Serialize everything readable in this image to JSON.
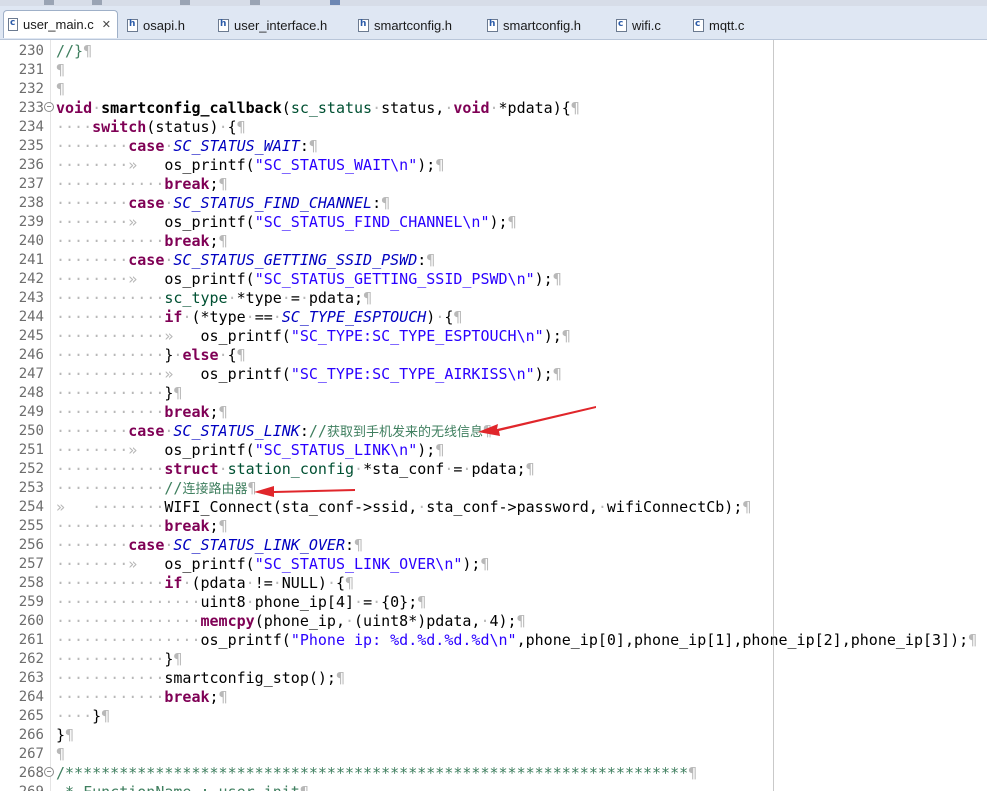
{
  "tabs": [
    {
      "label": "user_main.c",
      "icon": "c-file-icon",
      "glyph": "c",
      "active": true,
      "close": "✕"
    },
    {
      "label": "osapi.h",
      "icon": "h-file-icon",
      "glyph": "h"
    },
    {
      "label": "user_interface.h",
      "icon": "h-file-icon",
      "glyph": "h"
    },
    {
      "label": "smartconfig.h",
      "icon": "h-file-icon",
      "glyph": "h"
    },
    {
      "label": "smartconfig.h",
      "icon": "h-file-icon",
      "glyph": "h"
    },
    {
      "label": "wifi.c",
      "icon": "c-file-icon",
      "glyph": "c"
    },
    {
      "label": "mqtt.c",
      "icon": "c-file-icon",
      "glyph": "c"
    }
  ],
  "editor": {
    "lines": [
      {
        "n": "230",
        "t": [
          [
            "cm",
            "//}"
          ],
          [
            "ws",
            "¶"
          ]
        ]
      },
      {
        "n": "231",
        "t": [
          [
            "ws",
            "¶"
          ]
        ]
      },
      {
        "n": "232",
        "t": [
          [
            "ws",
            "¶"
          ]
        ]
      },
      {
        "n": "233",
        "fold": "−",
        "t": [
          [
            "kw",
            "void"
          ],
          [
            "ws",
            "·"
          ],
          [
            "fn",
            "smartconfig_callback"
          ],
          [
            "",
            "("
          ],
          [
            "ty",
            "sc_status"
          ],
          [
            "ws",
            "·"
          ],
          [
            "",
            "status,"
          ],
          [
            "ws",
            "·"
          ],
          [
            "kw",
            "void"
          ],
          [
            "ws",
            "·"
          ],
          [
            "",
            "*pdata){"
          ],
          [
            "ws",
            "¶"
          ]
        ]
      },
      {
        "n": "234",
        "t": [
          [
            "ws",
            "····"
          ],
          [
            "kw",
            "switch"
          ],
          [
            "",
            "(status)"
          ],
          [
            "ws",
            "·"
          ],
          [
            "",
            "{"
          ],
          [
            "ws",
            "¶"
          ]
        ]
      },
      {
        "n": "235",
        "t": [
          [
            "ws",
            "········"
          ],
          [
            "kw",
            "case"
          ],
          [
            "ws",
            "·"
          ],
          [
            "mac",
            "SC_STATUS_WAIT"
          ],
          [
            "",
            ":"
          ],
          [
            "ws",
            "¶"
          ]
        ]
      },
      {
        "n": "236",
        "t": [
          [
            "ws",
            "········»   "
          ],
          [
            "",
            "os_printf("
          ],
          [
            "str",
            "\"SC_STATUS_WAIT\\n\""
          ],
          [
            "",
            ");"
          ],
          [
            "ws",
            "¶"
          ]
        ]
      },
      {
        "n": "237",
        "t": [
          [
            "ws",
            "············"
          ],
          [
            "kw",
            "break"
          ],
          [
            "",
            ";"
          ],
          [
            "ws",
            "¶"
          ]
        ]
      },
      {
        "n": "238",
        "t": [
          [
            "ws",
            "········"
          ],
          [
            "kw",
            "case"
          ],
          [
            "ws",
            "·"
          ],
          [
            "mac",
            "SC_STATUS_FIND_CHANNEL"
          ],
          [
            "",
            ":"
          ],
          [
            "ws",
            "¶"
          ]
        ]
      },
      {
        "n": "239",
        "t": [
          [
            "ws",
            "········»   "
          ],
          [
            "",
            "os_printf("
          ],
          [
            "str",
            "\"SC_STATUS_FIND_CHANNEL\\n\""
          ],
          [
            "",
            ");"
          ],
          [
            "ws",
            "¶"
          ]
        ]
      },
      {
        "n": "240",
        "t": [
          [
            "ws",
            "············"
          ],
          [
            "kw",
            "break"
          ],
          [
            "",
            ";"
          ],
          [
            "ws",
            "¶"
          ]
        ]
      },
      {
        "n": "241",
        "t": [
          [
            "ws",
            "········"
          ],
          [
            "kw",
            "case"
          ],
          [
            "ws",
            "·"
          ],
          [
            "mac",
            "SC_STATUS_GETTING_SSID_PSWD"
          ],
          [
            "",
            ":"
          ],
          [
            "ws",
            "¶"
          ]
        ]
      },
      {
        "n": "242",
        "t": [
          [
            "ws",
            "········»   "
          ],
          [
            "",
            "os_printf("
          ],
          [
            "str",
            "\"SC_STATUS_GETTING_SSID_PSWD\\n\""
          ],
          [
            "",
            ");"
          ],
          [
            "ws",
            "¶"
          ]
        ]
      },
      {
        "n": "243",
        "t": [
          [
            "ws",
            "············"
          ],
          [
            "ty",
            "sc_type"
          ],
          [
            "ws",
            "·"
          ],
          [
            "",
            "*type"
          ],
          [
            "ws",
            "·"
          ],
          [
            "",
            "="
          ],
          [
            "ws",
            "·"
          ],
          [
            "",
            "pdata;"
          ],
          [
            "ws",
            "¶"
          ]
        ]
      },
      {
        "n": "244",
        "t": [
          [
            "ws",
            "············"
          ],
          [
            "kw",
            "if"
          ],
          [
            "ws",
            "·"
          ],
          [
            "",
            "(*type"
          ],
          [
            "ws",
            "·"
          ],
          [
            "",
            "=="
          ],
          [
            "ws",
            "·"
          ],
          [
            "mac",
            "SC_TYPE_ESPTOUCH"
          ],
          [
            "",
            ")"
          ],
          [
            "ws",
            "·"
          ],
          [
            "",
            "{"
          ],
          [
            "ws",
            "¶"
          ]
        ]
      },
      {
        "n": "245",
        "t": [
          [
            "ws",
            "············»   "
          ],
          [
            "",
            "os_printf("
          ],
          [
            "str",
            "\"SC_TYPE:SC_TYPE_ESPTOUCH\\n\""
          ],
          [
            "",
            ");"
          ],
          [
            "ws",
            "¶"
          ]
        ]
      },
      {
        "n": "246",
        "t": [
          [
            "ws",
            "············"
          ],
          [
            "",
            "}"
          ],
          [
            "ws",
            "·"
          ],
          [
            "kw",
            "else"
          ],
          [
            "ws",
            "·"
          ],
          [
            "",
            "{"
          ],
          [
            "ws",
            "¶"
          ]
        ]
      },
      {
        "n": "247",
        "t": [
          [
            "ws",
            "············»   "
          ],
          [
            "",
            "os_printf("
          ],
          [
            "str",
            "\"SC_TYPE:SC_TYPE_AIRKISS\\n\""
          ],
          [
            "",
            ");"
          ],
          [
            "ws",
            "¶"
          ]
        ]
      },
      {
        "n": "248",
        "t": [
          [
            "ws",
            "············"
          ],
          [
            "",
            "}"
          ],
          [
            "ws",
            "¶"
          ]
        ]
      },
      {
        "n": "249",
        "t": [
          [
            "ws",
            "············"
          ],
          [
            "kw",
            "break"
          ],
          [
            "",
            ";"
          ],
          [
            "ws",
            "¶"
          ]
        ]
      },
      {
        "n": "250",
        "t": [
          [
            "ws",
            "········"
          ],
          [
            "kw",
            "case"
          ],
          [
            "ws",
            "·"
          ],
          [
            "mac",
            "SC_STATUS_LINK"
          ],
          [
            "",
            ":"
          ],
          [
            "cm",
            "//"
          ],
          [
            "cmt",
            "获取到手机发来的无线信息"
          ],
          [
            "ws",
            "¶"
          ]
        ]
      },
      {
        "n": "251",
        "t": [
          [
            "ws",
            "········»   "
          ],
          [
            "",
            "os_printf("
          ],
          [
            "str",
            "\"SC_STATUS_LINK\\n\""
          ],
          [
            "",
            ");"
          ],
          [
            "ws",
            "¶"
          ]
        ]
      },
      {
        "n": "252",
        "t": [
          [
            "ws",
            "············"
          ],
          [
            "kw",
            "struct"
          ],
          [
            "ws",
            "·"
          ],
          [
            "ty",
            "station_config"
          ],
          [
            "ws",
            "·"
          ],
          [
            "",
            "*sta_conf"
          ],
          [
            "ws",
            "·"
          ],
          [
            "",
            "="
          ],
          [
            "ws",
            "·"
          ],
          [
            "",
            "pdata;"
          ],
          [
            "ws",
            "¶"
          ]
        ]
      },
      {
        "n": "253",
        "t": [
          [
            "ws",
            "············"
          ],
          [
            "cm",
            "//"
          ],
          [
            "cmt",
            "连接路由器"
          ],
          [
            "ws",
            "¶"
          ]
        ]
      },
      {
        "n": "254",
        "t": [
          [
            "ws",
            "»   ········"
          ],
          [
            "",
            "WIFI_Connect(sta_conf->ssid,"
          ],
          [
            "ws",
            "·"
          ],
          [
            "",
            "sta_conf->password,"
          ],
          [
            "ws",
            "·"
          ],
          [
            "",
            "wifiConnectCb);"
          ],
          [
            "ws",
            "¶"
          ]
        ]
      },
      {
        "n": "255",
        "t": [
          [
            "ws",
            "············"
          ],
          [
            "kw",
            "break"
          ],
          [
            "",
            ";"
          ],
          [
            "ws",
            "¶"
          ]
        ]
      },
      {
        "n": "256",
        "t": [
          [
            "ws",
            "········"
          ],
          [
            "kw",
            "case"
          ],
          [
            "ws",
            "·"
          ],
          [
            "mac",
            "SC_STATUS_LINK_OVER"
          ],
          [
            "",
            ":"
          ],
          [
            "ws",
            "¶"
          ]
        ]
      },
      {
        "n": "257",
        "t": [
          [
            "ws",
            "········»   "
          ],
          [
            "",
            "os_printf("
          ],
          [
            "str",
            "\"SC_STATUS_LINK_OVER\\n\""
          ],
          [
            "",
            ");"
          ],
          [
            "ws",
            "¶"
          ]
        ]
      },
      {
        "n": "258",
        "t": [
          [
            "ws",
            "············"
          ],
          [
            "kw",
            "if"
          ],
          [
            "ws",
            "·"
          ],
          [
            "",
            "(pdata"
          ],
          [
            "ws",
            "·"
          ],
          [
            "",
            "!="
          ],
          [
            "ws",
            "·"
          ],
          [
            "",
            "NULL)"
          ],
          [
            "ws",
            "·"
          ],
          [
            "",
            "{"
          ],
          [
            "ws",
            "¶"
          ]
        ]
      },
      {
        "n": "259",
        "t": [
          [
            "ws",
            "················"
          ],
          [
            "",
            "uint8"
          ],
          [
            "ws",
            "·"
          ],
          [
            "",
            "phone_ip[4]"
          ],
          [
            "ws",
            "·"
          ],
          [
            "",
            "="
          ],
          [
            "ws",
            "·"
          ],
          [
            "",
            "{0};"
          ],
          [
            "ws",
            "¶"
          ]
        ]
      },
      {
        "n": "260",
        "t": [
          [
            "ws",
            "················"
          ],
          [
            "kw",
            "memcpy"
          ],
          [
            "",
            "(phone_ip,"
          ],
          [
            "ws",
            "·"
          ],
          [
            "",
            "(uint8*)pdata,"
          ],
          [
            "ws",
            "·"
          ],
          [
            "",
            "4);"
          ],
          [
            "ws",
            "¶"
          ]
        ]
      },
      {
        "n": "261",
        "t": [
          [
            "ws",
            "················"
          ],
          [
            "",
            "os_printf("
          ],
          [
            "str",
            "\"Phone ip: %d.%d.%d.%d\\n\""
          ],
          [
            "",
            ",phone_ip[0],phone_ip[1],phone_ip[2],phone_ip[3]);"
          ],
          [
            "ws",
            "¶"
          ]
        ]
      },
      {
        "n": "262",
        "t": [
          [
            "ws",
            "············"
          ],
          [
            "",
            "}"
          ],
          [
            "ws",
            "¶"
          ]
        ]
      },
      {
        "n": "263",
        "t": [
          [
            "ws",
            "············"
          ],
          [
            "",
            "smartconfig_stop();"
          ],
          [
            "ws",
            "¶"
          ]
        ]
      },
      {
        "n": "264",
        "t": [
          [
            "ws",
            "············"
          ],
          [
            "kw",
            "break"
          ],
          [
            "",
            ";"
          ],
          [
            "ws",
            "¶"
          ]
        ]
      },
      {
        "n": "265",
        "t": [
          [
            "ws",
            "····"
          ],
          [
            "",
            "}"
          ],
          [
            "ws",
            "¶"
          ]
        ]
      },
      {
        "n": "266",
        "t": [
          [
            "",
            "}"
          ],
          [
            "ws",
            "¶"
          ]
        ]
      },
      {
        "n": "267",
        "t": [
          [
            "ws",
            "¶"
          ]
        ]
      },
      {
        "n": "268",
        "fold": "−",
        "t": [
          [
            "cm",
            "/*********************************************************************"
          ],
          [
            "ws",
            "¶"
          ]
        ]
      },
      {
        "n": "269",
        "t": [
          [
            "cm",
            " * FunctionName : user_init"
          ],
          [
            "ws",
            "¶"
          ]
        ]
      }
    ]
  },
  "annotation_color": "#e0262b"
}
